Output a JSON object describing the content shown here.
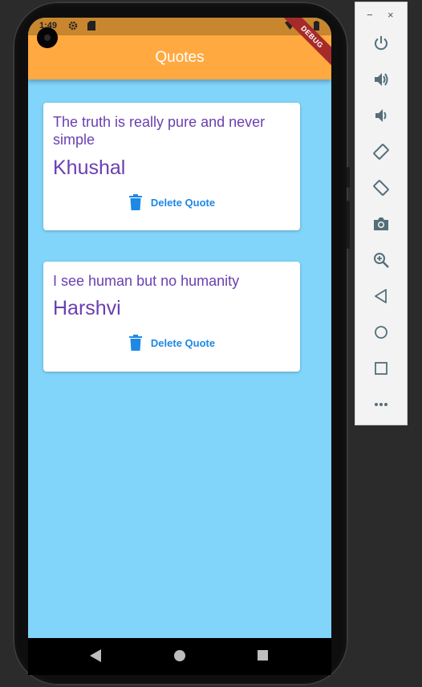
{
  "status": {
    "time": "1:49",
    "settings_icon": "gear-icon",
    "sd_icon": "sd-card-icon",
    "wifi_icon": "wifi-icon",
    "battery_icon": "battery-icon"
  },
  "app": {
    "title": "Quotes",
    "debug_banner": "DEBUG",
    "bar_color": "#ffa940",
    "background_color": "#81d4fa"
  },
  "quotes": [
    {
      "text": "The truth is really pure and never simple",
      "author": "Khushal",
      "action_label": "Delete Quote"
    },
    {
      "text": "I see human but no humanity",
      "author": "Harshvi",
      "action_label": "Delete Quote"
    }
  ],
  "nav": [
    "back-icon",
    "home-icon",
    "recents-icon"
  ],
  "emulator_toolbar": {
    "minimize": "−",
    "close": "×",
    "buttons": [
      "power-icon",
      "volume-up-icon",
      "volume-down-icon",
      "rotate-left-icon",
      "rotate-right-icon",
      "camera-icon",
      "zoom-icon",
      "back-icon",
      "home-icon",
      "overview-icon",
      "more-icon"
    ]
  },
  "colors": {
    "accent_text": "#6a3fb0",
    "action": "#1e88e5",
    "debug_ribbon": "#a52a2a"
  }
}
